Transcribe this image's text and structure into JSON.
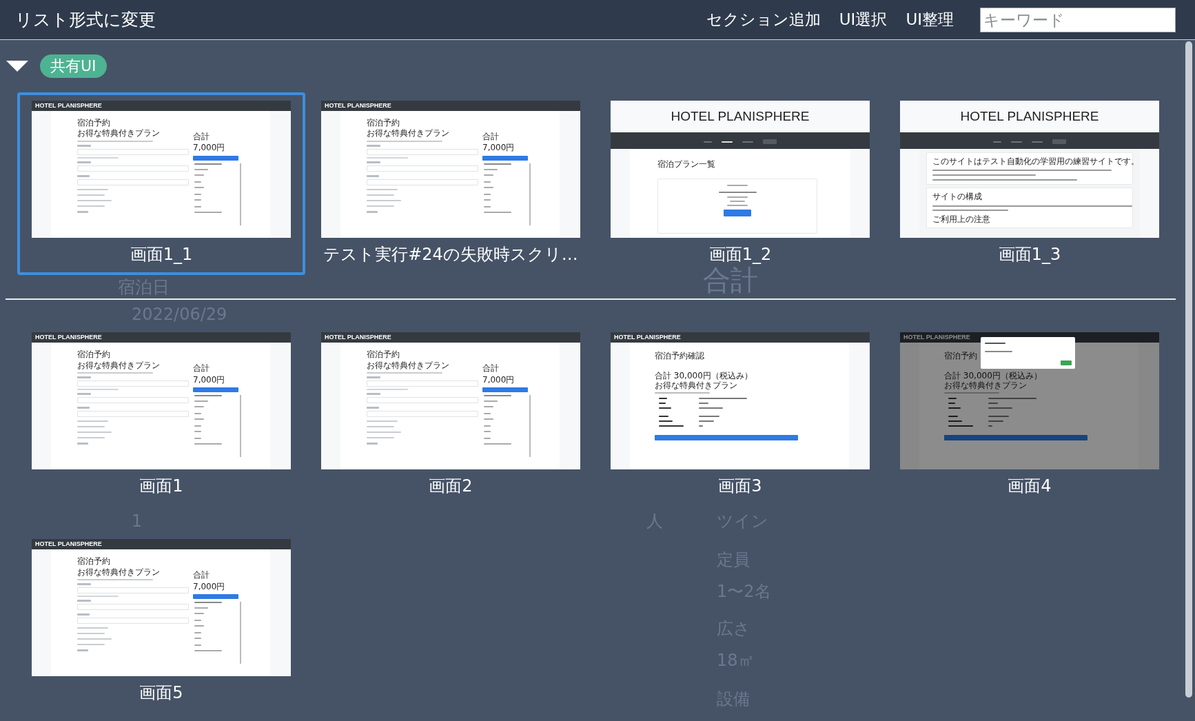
{
  "toolbar": {
    "view_toggle": "リスト形式に変更",
    "actions": [
      "セクション追加",
      "UI選択",
      "UI整理"
    ],
    "search": {
      "placeholder": "キーワード"
    }
  },
  "background_page": {
    "texts": [
      "宿泊日",
      "2022/06/29",
      "合計",
      "1",
      "人",
      "ツイン",
      "定員",
      "1〜2名",
      "広さ",
      "18㎡",
      "設備"
    ]
  },
  "sections": [
    {
      "label": "共有UI",
      "expanded": true,
      "groups": [
        {
          "items": [
            {
              "label": "画面1_1",
              "selected": true,
              "screenshot": {
                "kind": "form",
                "header": "HOTEL PLANISPHERE",
                "title": "宿泊予約",
                "subtitle": "お得な特典付きプラン",
                "total_label": "合計",
                "total": "7,000円"
              }
            },
            {
              "label": "テスト実行#24の失敗時スクリ…",
              "selected": false,
              "screenshot": {
                "kind": "form",
                "header": "HOTEL PLANISPHERE",
                "title": "宿泊予約",
                "subtitle": "お得な特典付きプラン",
                "total_label": "合計",
                "total": "7,000円"
              }
            },
            {
              "label": "画面1_2",
              "selected": false,
              "screenshot": {
                "kind": "plans",
                "header": "HOTEL PLANISPHERE",
                "title": "宿泊プラン一覧"
              }
            },
            {
              "label": "画面1_3",
              "selected": false,
              "screenshot": {
                "kind": "home",
                "header": "HOTEL PLANISPHERE",
                "title": "このサイトはテスト自動化の学習用の練習サイトです。",
                "section_1": "サイトの構成",
                "section_2": "ご利用上の注意"
              }
            }
          ]
        },
        {
          "items": [
            {
              "label": "画面1",
              "selected": false,
              "screenshot": {
                "kind": "form",
                "header": "HOTEL PLANISPHERE",
                "title": "宿泊予約",
                "subtitle": "お得な特典付きプラン",
                "total_label": "合計",
                "total": "7,000円"
              }
            },
            {
              "label": "画面2",
              "selected": false,
              "screenshot": {
                "kind": "form",
                "header": "HOTEL PLANISPHERE",
                "title": "宿泊予約",
                "subtitle": "お得な特典付きプラン",
                "total_label": "合計",
                "total": "7,000円"
              }
            },
            {
              "label": "画面3",
              "selected": false,
              "screenshot": {
                "kind": "confirm",
                "header": "HOTEL PLANISPHERE",
                "title": "宿泊予約確認",
                "total": "合計 30,000円（税込み）",
                "subtitle": "お得な特典付きプラン",
                "dialog_open": false
              }
            },
            {
              "label": "画面4",
              "selected": false,
              "screenshot": {
                "kind": "confirm",
                "header": "HOTEL PLANISPHERE",
                "title": "宿泊予約",
                "total": "合計 30,000円（税込み）",
                "subtitle": "お得な特典付きプラン",
                "dialog_open": true
              }
            },
            {
              "label": "画面5",
              "selected": false,
              "screenshot": {
                "kind": "form",
                "header": "HOTEL PLANISPHERE",
                "title": "宿泊予約",
                "subtitle": "お得な特典付きプラン",
                "total_label": "合計",
                "total": "7,000円"
              }
            }
          ]
        }
      ]
    }
  ]
}
